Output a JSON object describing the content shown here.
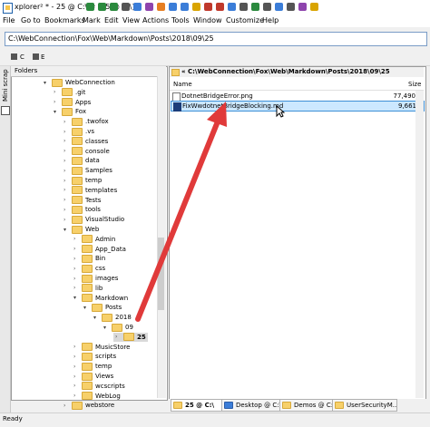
{
  "window": {
    "title": "xplorer² * - 25 @ C:\\ # [25 @ C:\\]"
  },
  "menu": [
    "File",
    "Go to",
    "Bookmarks",
    "Mark",
    "Edit",
    "View",
    "Actions",
    "Tools",
    "Window",
    "Customize",
    "Help"
  ],
  "address": {
    "value": "C:\\WebConnection\\Fox\\Web\\Markdown\\Posts\\2018\\09\\25"
  },
  "left_strip": {
    "label": "Mini scrap"
  },
  "folders": {
    "title": "Folders",
    "items": [
      {
        "label": "WebConnection",
        "level": 0,
        "expanded": true
      },
      {
        "label": ".git",
        "level": 1
      },
      {
        "label": "Apps",
        "level": 1
      },
      {
        "label": "Fox",
        "level": 1,
        "expanded": true
      },
      {
        "label": ".twofox",
        "level": 2
      },
      {
        "label": ".vs",
        "level": 2
      },
      {
        "label": "classes",
        "level": 2
      },
      {
        "label": "console",
        "level": 2
      },
      {
        "label": "data",
        "level": 2
      },
      {
        "label": "Samples",
        "level": 2
      },
      {
        "label": "temp",
        "level": 2
      },
      {
        "label": "templates",
        "level": 2
      },
      {
        "label": "Tests",
        "level": 2
      },
      {
        "label": "tools",
        "level": 2
      },
      {
        "label": "VisualStudio",
        "level": 2
      },
      {
        "label": "Web",
        "level": 2,
        "expanded": true
      },
      {
        "label": "Admin",
        "level": 3
      },
      {
        "label": "App_Data",
        "level": 3
      },
      {
        "label": "Bin",
        "level": 3
      },
      {
        "label": "css",
        "level": 3
      },
      {
        "label": "images",
        "level": 3
      },
      {
        "label": "lib",
        "level": 3
      },
      {
        "label": "Markdown",
        "level": 3,
        "expanded": true
      },
      {
        "label": "Posts",
        "level": 4,
        "expanded": true
      },
      {
        "label": "2018",
        "level": 5,
        "expanded": true
      },
      {
        "label": "09",
        "level": 6,
        "expanded": true
      },
      {
        "label": "25",
        "level": 7,
        "selected": true
      },
      {
        "label": "MusicStore",
        "level": 3
      },
      {
        "label": "scripts",
        "level": 3
      },
      {
        "label": "temp",
        "level": 3
      },
      {
        "label": "Views",
        "level": 3
      },
      {
        "label": "wcscripts",
        "level": 3
      },
      {
        "label": "WebLog",
        "level": 3
      },
      {
        "label": "webstore",
        "level": 2
      }
    ]
  },
  "files": {
    "path": "« C:\\WebConnection\\Fox\\Web\\Markdown\\Posts\\2018\\09\\25",
    "col_name": "Name",
    "col_size": "Size",
    "rows": [
      {
        "name": "DotnetBridgeError.png",
        "size": "77,490"
      },
      {
        "name": "FixWwdotnetBridgeBlocking.md",
        "size": "9,661",
        "selected": true
      }
    ]
  },
  "tabs": [
    {
      "label": "25 @ C:\\",
      "active": true
    },
    {
      "label": "Desktop @ C:\\"
    },
    {
      "label": "Demos @ C:\\"
    },
    {
      "label": "UserSecurityM..."
    }
  ],
  "status": {
    "text": "Ready"
  },
  "colors": {
    "arrow": "#e03a3a",
    "selection": "#cce8ff",
    "folder": "#f7d06a"
  }
}
